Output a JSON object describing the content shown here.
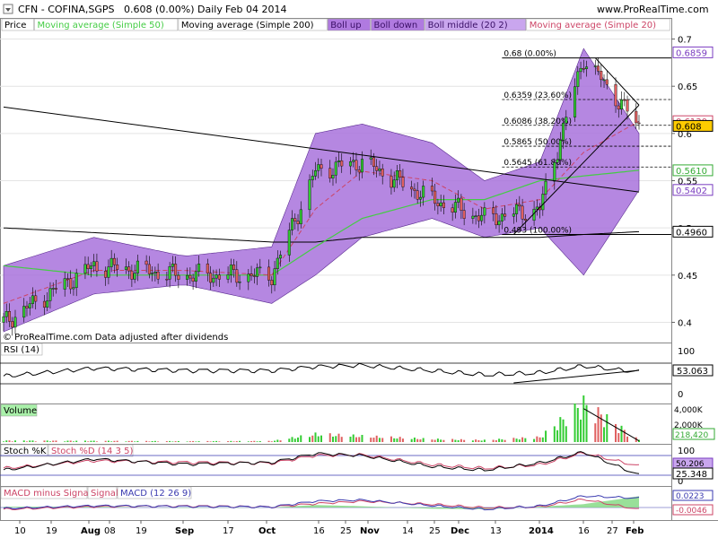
{
  "header": {
    "title": "CFN - COFINA,SGPS",
    "quote": "0.608 (0.00%)",
    "period": "Daily",
    "date": "Feb 04 2014",
    "site": "www.ProRealTime.com"
  },
  "legend": [
    {
      "label": "Price",
      "color": "#000000",
      "bg": "#ffffff"
    },
    {
      "label": "Moving average (Simple 50)",
      "color": "#44cc44",
      "bg": "#ffffff"
    },
    {
      "label": "Moving average (Simple 200)",
      "color": "#000000",
      "bg": "#ffffff"
    },
    {
      "label": "Boll up",
      "color": "#3a0f66",
      "bg": "#b07ae0"
    },
    {
      "label": "Boll down",
      "color": "#3a0f66",
      "bg": "#b07ae0"
    },
    {
      "label": "Boll middle (20 2)",
      "color": "#3a0f66",
      "bg": "#c9a6ee"
    },
    {
      "label": "Moving average (Simple 20)",
      "color": "#cc4466",
      "bg": "#ffffff"
    }
  ],
  "footnote": "© ProRealTime.com  Data adjusted after dividends",
  "colors": {
    "up": "#33cc33",
    "down": "#e06060",
    "band": "#a872dc",
    "ma50": "#44cc44",
    "ma20": "#cc4466",
    "ma200": "#000000"
  },
  "x_labels": [
    "10",
    "19",
    "Aug",
    "08",
    "19",
    "Sep",
    "17",
    "Oct",
    "16",
    "25",
    "Nov",
    "14",
    "25",
    "Dec",
    "13",
    "2014",
    "16",
    "27",
    "Feb"
  ],
  "price_axis": [
    "0.7",
    "0.65",
    "0.6",
    "0.55",
    "0.5",
    "0.45",
    "0.4"
  ],
  "price_badges": [
    {
      "text": "0.6859",
      "value": 0.6859,
      "color": "#7a3cc0"
    },
    {
      "text": "0.6130",
      "value": 0.613,
      "color": "#cc4466"
    },
    {
      "text": "0.608",
      "value": 0.608,
      "color": "#000000",
      "bg": "#ffcc00"
    },
    {
      "text": "0.5610",
      "value": 0.561,
      "color": "#33aa33"
    },
    {
      "text": "0.5402",
      "value": 0.5402,
      "color": "#7a3cc0"
    },
    {
      "text": "0.4960",
      "value": 0.496,
      "color": "#000000"
    }
  ],
  "fib_levels": [
    {
      "text": "0.68 (0.00%)",
      "value": 0.68
    },
    {
      "text": "0.6359 (23.60%)",
      "value": 0.6359
    },
    {
      "text": "0.6086 (38.20%)",
      "value": 0.6086
    },
    {
      "text": "0.5865 (50.00%)",
      "value": 0.5865
    },
    {
      "text": "0.5645 (61.80%)",
      "value": 0.5645
    },
    {
      "text": "0.493 (100.00%)",
      "value": 0.493
    }
  ],
  "panels": {
    "rsi": {
      "label": "RSI (14)",
      "axis": [
        "100",
        "0"
      ],
      "value": "53.063"
    },
    "volume": {
      "label": "Volume",
      "axis": [
        "4,000K",
        "2,000K",
        "0"
      ],
      "value": "218,420"
    },
    "stoch": {
      "labels": [
        "Stoch %K",
        "Stoch %D (14 3 5)"
      ],
      "axis": [
        "100",
        "0"
      ],
      "values": [
        "50.206",
        "25.348"
      ]
    },
    "macd": {
      "labels": [
        "MACD minus Signal",
        "Signal",
        "MACD (12 26 9)"
      ],
      "values": [
        "0.0223",
        "-0.0046"
      ]
    }
  },
  "chart_data": {
    "type": "line",
    "title": "CFN - COFINA,SGPS",
    "xlabel": "",
    "ylabel": "",
    "ylim": [
      0.39,
      0.71
    ],
    "x_range": [
      "2013-07-01",
      "2014-02-04"
    ],
    "anchor_dates": [
      "2013-07-01",
      "2013-08-01",
      "2013-09-01",
      "2013-10-01",
      "2013-10-16",
      "2013-11-01",
      "2013-11-25",
      "2013-12-13",
      "2014-01-01",
      "2014-01-16",
      "2014-02-04"
    ],
    "close": [
      0.4,
      0.46,
      0.45,
      0.45,
      0.56,
      0.57,
      0.53,
      0.51,
      0.52,
      0.68,
      0.608
    ],
    "boll_up": [
      0.46,
      0.49,
      0.47,
      0.48,
      0.6,
      0.61,
      0.59,
      0.55,
      0.57,
      0.69,
      0.6
    ],
    "boll_down": [
      0.39,
      0.43,
      0.44,
      0.42,
      0.45,
      0.49,
      0.51,
      0.49,
      0.5,
      0.45,
      0.54
    ],
    "ma20": [
      0.42,
      0.455,
      0.455,
      0.45,
      0.52,
      0.56,
      0.55,
      0.52,
      0.53,
      0.58,
      0.613
    ],
    "ma50": [
      0.46,
      0.45,
      0.45,
      0.45,
      0.48,
      0.51,
      0.53,
      0.53,
      0.55,
      0.555,
      0.561
    ],
    "ma200": [
      0.5,
      0.495,
      0.49,
      0.485,
      0.485,
      0.49,
      0.49,
      0.49,
      0.49,
      0.493,
      0.496
    ],
    "trendlines": [
      {
        "from": [
          "2013-07-01",
          0.628
        ],
        "to": [
          "2014-02-04",
          0.538
        ]
      },
      {
        "from": [
          "2013-12-23",
          0.493
        ],
        "to": [
          "2014-02-04",
          0.63
        ]
      },
      {
        "from": [
          "2014-01-20",
          0.68
        ],
        "to": [
          "2014-02-04",
          0.63
        ]
      }
    ],
    "rsi": [
      45,
      60,
      55,
      55,
      63,
      66,
      56,
      48,
      52,
      65,
      53.063
    ],
    "volume_k": [
      150,
      120,
      80,
      100,
      800,
      600,
      300,
      200,
      500,
      4000,
      218.42
    ],
    "stoch_k": [
      40,
      70,
      55,
      60,
      85,
      80,
      50,
      40,
      60,
      90,
      25.348
    ],
    "stoch_d": [
      45,
      65,
      60,
      58,
      80,
      82,
      55,
      45,
      55,
      88,
      50.206
    ],
    "macd": [
      -0.002,
      0.004,
      0.002,
      0.001,
      0.015,
      0.018,
      0.005,
      -0.004,
      0.004,
      0.028,
      0.0223
    ],
    "macd_signal": [
      -0.004,
      0.002,
      0.003,
      0.001,
      0.009,
      0.015,
      0.008,
      0.0,
      0.002,
      0.02,
      -0.0046
    ]
  }
}
